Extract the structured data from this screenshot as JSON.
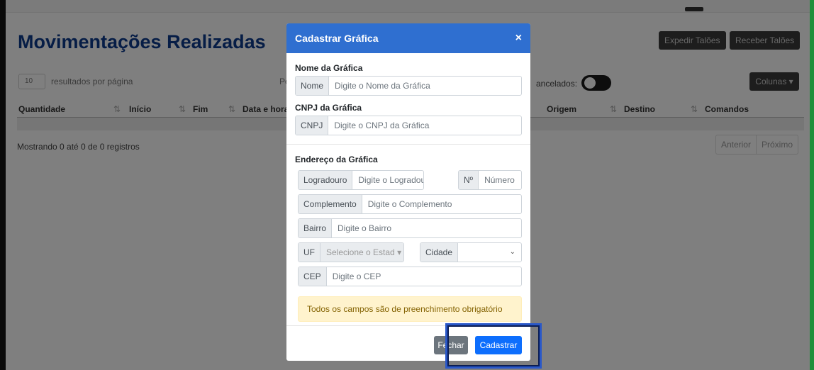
{
  "page": {
    "title": "Movimentações Realizadas",
    "buttons": {
      "expedir": "Expedir Talões",
      "receber": "Receber Talões"
    },
    "per_page_value": "10",
    "per_page_label": "resultados por página",
    "pe_label": "Pe",
    "cancelados_label": "ancelados:",
    "colunas_button": "Colunas ▾",
    "table_headers": [
      {
        "label": "Quantidade",
        "sort": "⇅"
      },
      {
        "label": "Início",
        "sort": "⇅"
      },
      {
        "label": "Fim",
        "sort": "⇅"
      },
      {
        "label": "Data e hora",
        "sort": ""
      },
      {
        "label": "Origem",
        "sort": "⇅"
      },
      {
        "label": "Destino",
        "sort": "⇅"
      },
      {
        "label": "Comandos",
        "sort": ""
      }
    ],
    "mostrando": "Mostrando 0 até 0 de 0 registros",
    "pager": {
      "prev": "Anterior",
      "next": "Próximo"
    }
  },
  "modal": {
    "title": "Cadastrar Gráfica",
    "close_icon": "×",
    "nome_section": "Nome da Gráfica",
    "nome": {
      "addon": "Nome",
      "placeholder": "Digite o Nome da Gráfica"
    },
    "cnpj_section": "CNPJ da Gráfica",
    "cnpj": {
      "addon": "CNPJ",
      "placeholder": "Digite o CNPJ da Gráfica"
    },
    "endereco_section": "Endereço da Gráfica",
    "logradouro": {
      "addon": "Logradouro",
      "placeholder": "Digite o Logradouro"
    },
    "numero": {
      "addon": "Nº",
      "placeholder": "Número"
    },
    "complemento": {
      "addon": "Complemento",
      "placeholder": "Digite o Complemento"
    },
    "bairro": {
      "addon": "Bairro",
      "placeholder": "Digite o Bairro"
    },
    "uf": {
      "addon": "UF",
      "placeholder": "Selecione o Estad",
      "caret": "▾"
    },
    "cidade": {
      "addon": "Cidade",
      "value": "",
      "caret": "⌄"
    },
    "cep": {
      "addon": "CEP",
      "placeholder": "Digite o CEP"
    },
    "alert": "Todos os campos são de preenchimento obrigatório",
    "footer": {
      "fechar": "Fechar",
      "cadastrar": "Cadastrar"
    }
  },
  "colors": {
    "header": "#2f6fd0",
    "title": "#0d3a8c",
    "primary": "#0d6efd",
    "alert_bg": "#fff3cd",
    "highlight": "#2a58c8"
  }
}
